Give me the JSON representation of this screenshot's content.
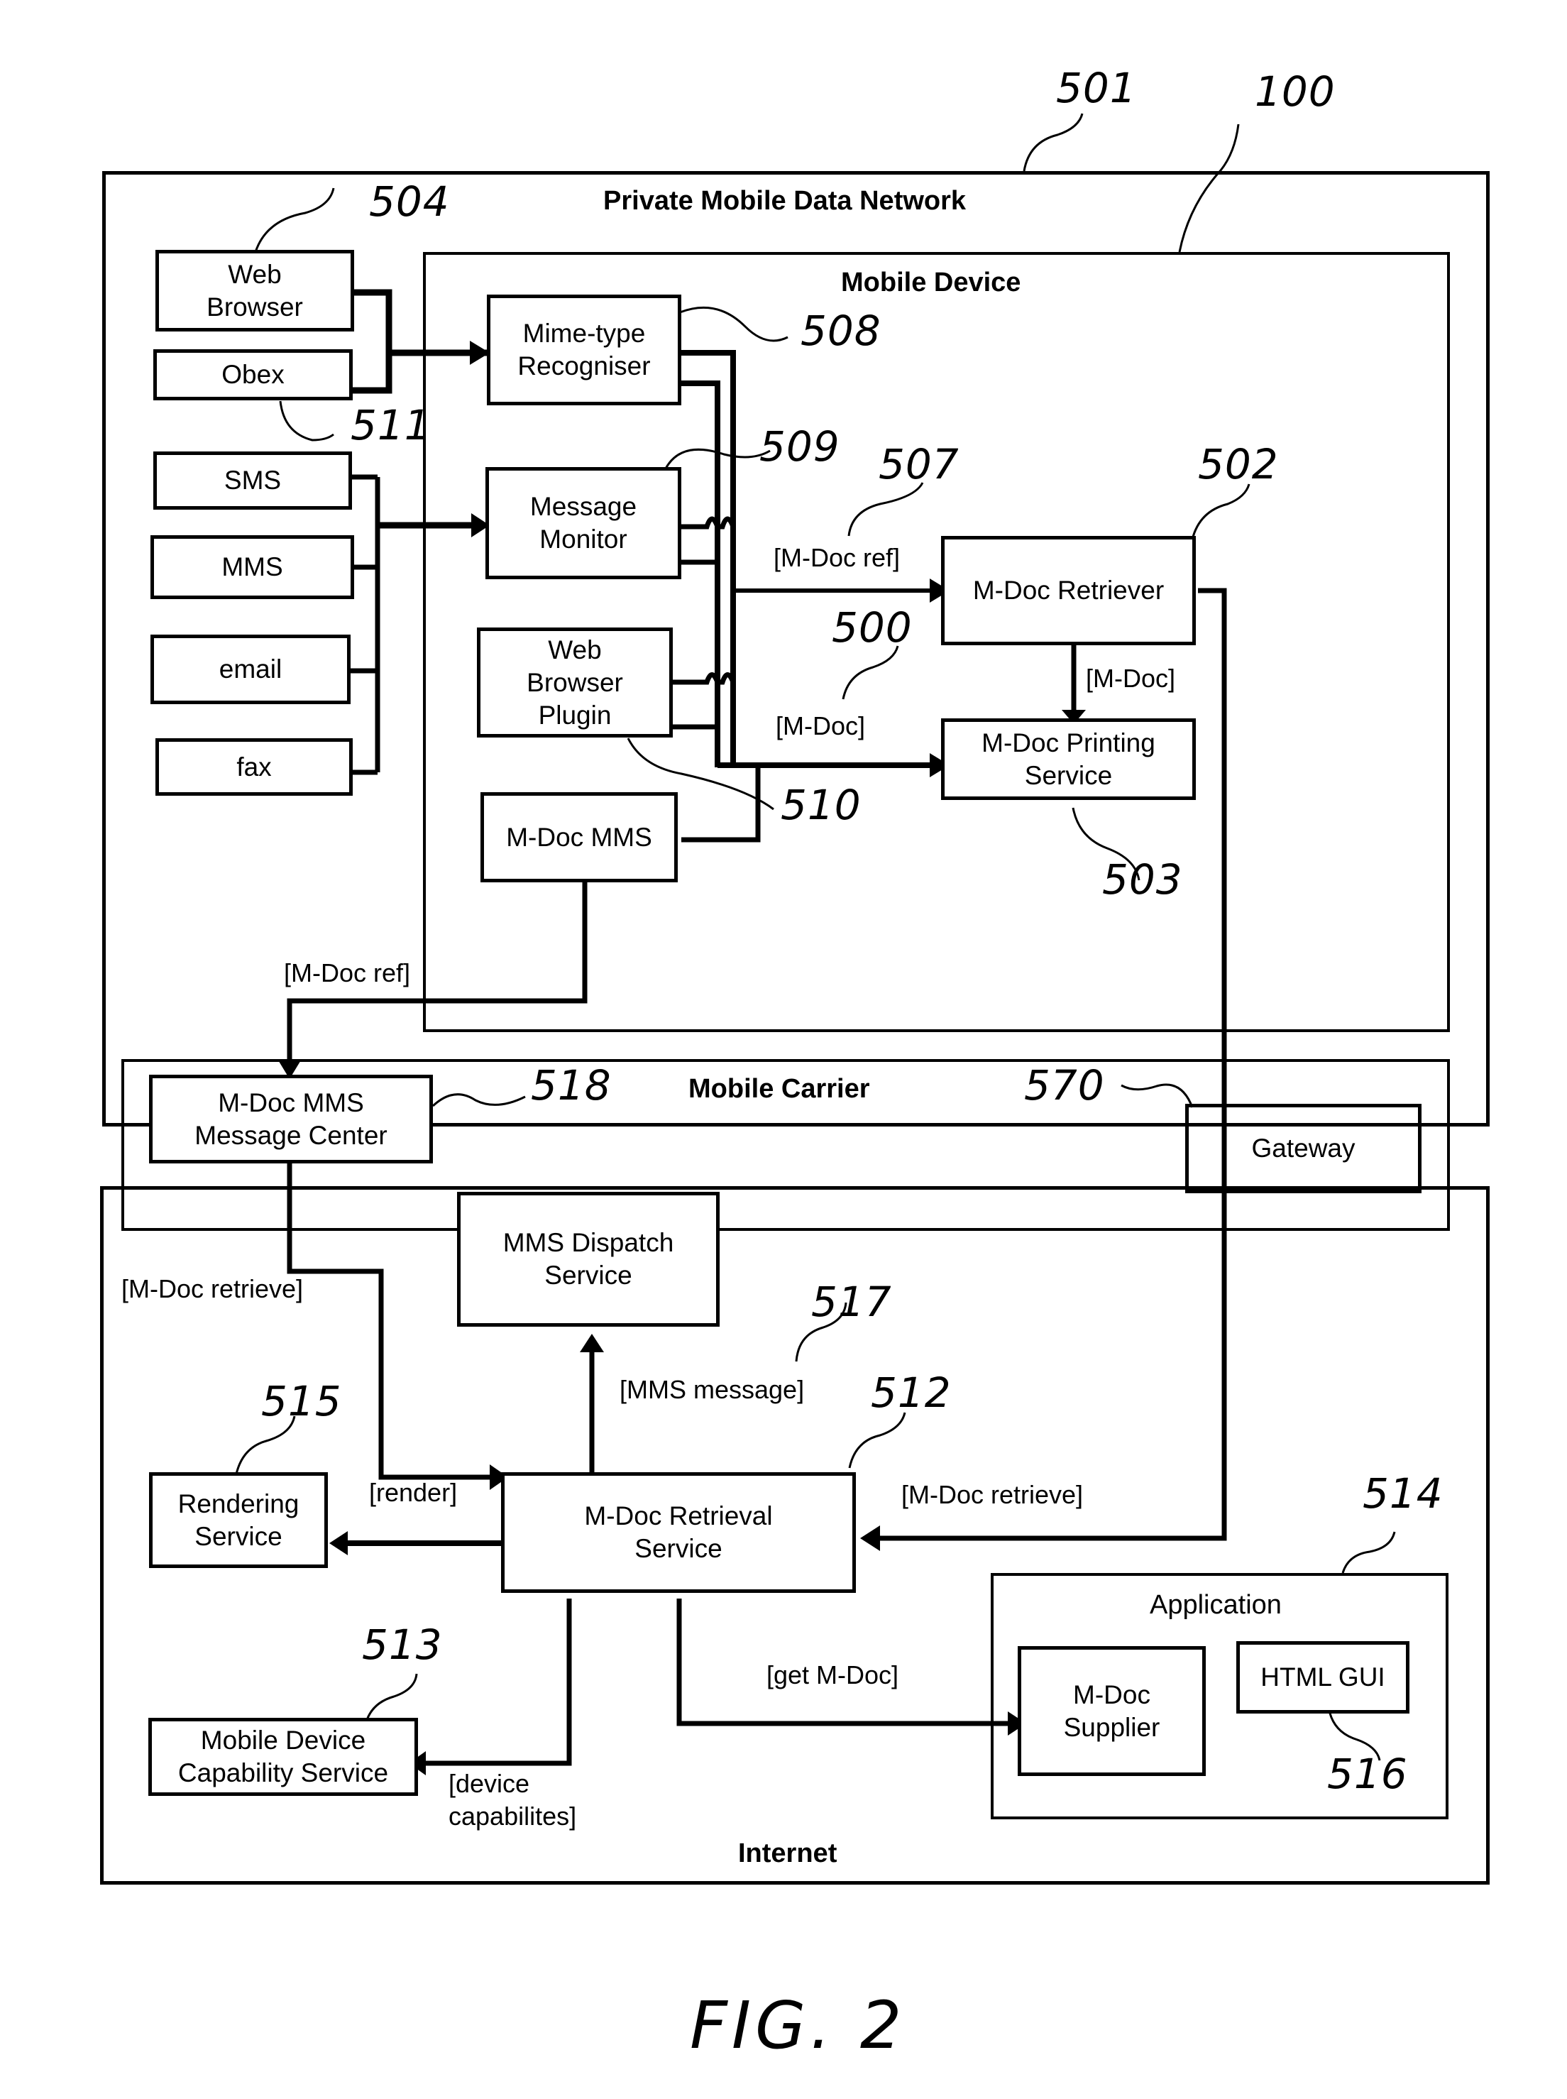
{
  "figure_caption": "FIG. 2",
  "regions": {
    "private_network": {
      "title": "Private Mobile Data Network",
      "ref": "501"
    },
    "mobile_device": {
      "title": "Mobile Device",
      "ref": "100"
    },
    "mobile_carrier": {
      "title": "Mobile Carrier"
    },
    "internet": {
      "title": "Internet"
    },
    "application": {
      "title": "Application",
      "ref": "514"
    }
  },
  "nodes": {
    "web_browser": {
      "label": "Web\nBrowser",
      "ref": "504"
    },
    "obex": {
      "label": "Obex",
      "ref": "511"
    },
    "sms": {
      "label": "SMS"
    },
    "mms": {
      "label": "MMS"
    },
    "email": {
      "label": "email"
    },
    "fax": {
      "label": "fax"
    },
    "mime_recogniser": {
      "label": "Mime-type\nRecogniser",
      "ref": "508"
    },
    "message_monitor": {
      "label": "Message\nMonitor",
      "ref": "509"
    },
    "web_browser_plugin": {
      "label": "Web\nBrowser\nPlugin",
      "ref": "510"
    },
    "mdoc_mms": {
      "label": "M-Doc MMS"
    },
    "mdoc_retriever": {
      "label": "M-Doc Retriever",
      "ref": "502"
    },
    "mdoc_printing": {
      "label": "M-Doc Printing\nService",
      "ref": "503"
    },
    "mms_message_center": {
      "label": "M-Doc MMS\nMessage Center",
      "ref": "518"
    },
    "gateway": {
      "label": "Gateway",
      "ref": "570"
    },
    "mms_dispatch": {
      "label": "MMS Dispatch\nService"
    },
    "rendering_service": {
      "label": "Rendering\nService",
      "ref": "515"
    },
    "retrieval_service": {
      "label": "M-Doc Retrieval\nService",
      "ref": "512"
    },
    "capability_service": {
      "label": "Mobile Device\nCapability Service",
      "ref": "513"
    },
    "mdoc_supplier": {
      "label": "M-Doc\nSupplier"
    },
    "html_gui": {
      "label": "HTML GUI",
      "ref": "516"
    }
  },
  "flow_labels": {
    "mdoc_ref_to_retriever": "[M-Doc ref]",
    "mdoc_ref_ref": "507",
    "mdoc_to_printing": "[M-Doc]",
    "mdoc_to_printing_ref": "500",
    "retriever_to_printing": "[M-Doc]",
    "mms_to_center": "[M-Doc ref]",
    "center_retrieve": "[M-Doc retrieve]",
    "mms_message": "[MMS message]",
    "mms_message_ref": "517",
    "render": "[render]",
    "gateway_retrieve": "[M-Doc retrieve]",
    "get_mdoc": "[get M-Doc]",
    "device_capabilities": "[device\ncapabilites]"
  }
}
